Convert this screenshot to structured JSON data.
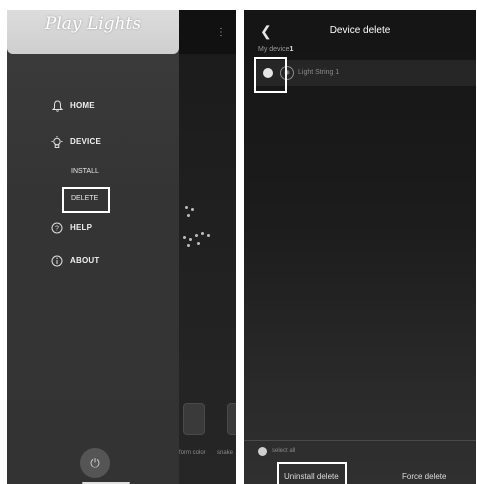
{
  "left_screen": {
    "logo": "Play Lights",
    "nav": {
      "home": "HOME",
      "device": "DEVICE",
      "install": "INSTALL",
      "delete": "DELETE",
      "help": "HELP",
      "about": "ABOUT"
    },
    "background": {
      "tile_labels": [
        "form color",
        "snake"
      ]
    }
  },
  "right_screen": {
    "title": "Device delete",
    "section_prefix": "My device",
    "section_count": "1",
    "devices": [
      {
        "name": "Light String 1"
      }
    ],
    "select_all": "select all",
    "uninstall_button": "Uninstall delete",
    "force_button": "Force delete"
  },
  "icons": {
    "home": "bell-icon",
    "device": "bulb-icon",
    "help": "question-icon",
    "about": "info-icon",
    "power": "power-icon",
    "back": "chevron-left-icon"
  },
  "colors": {
    "highlight": "#ffffff",
    "drawer_bg": "#383838",
    "header_bg": "#d5d5d5"
  }
}
